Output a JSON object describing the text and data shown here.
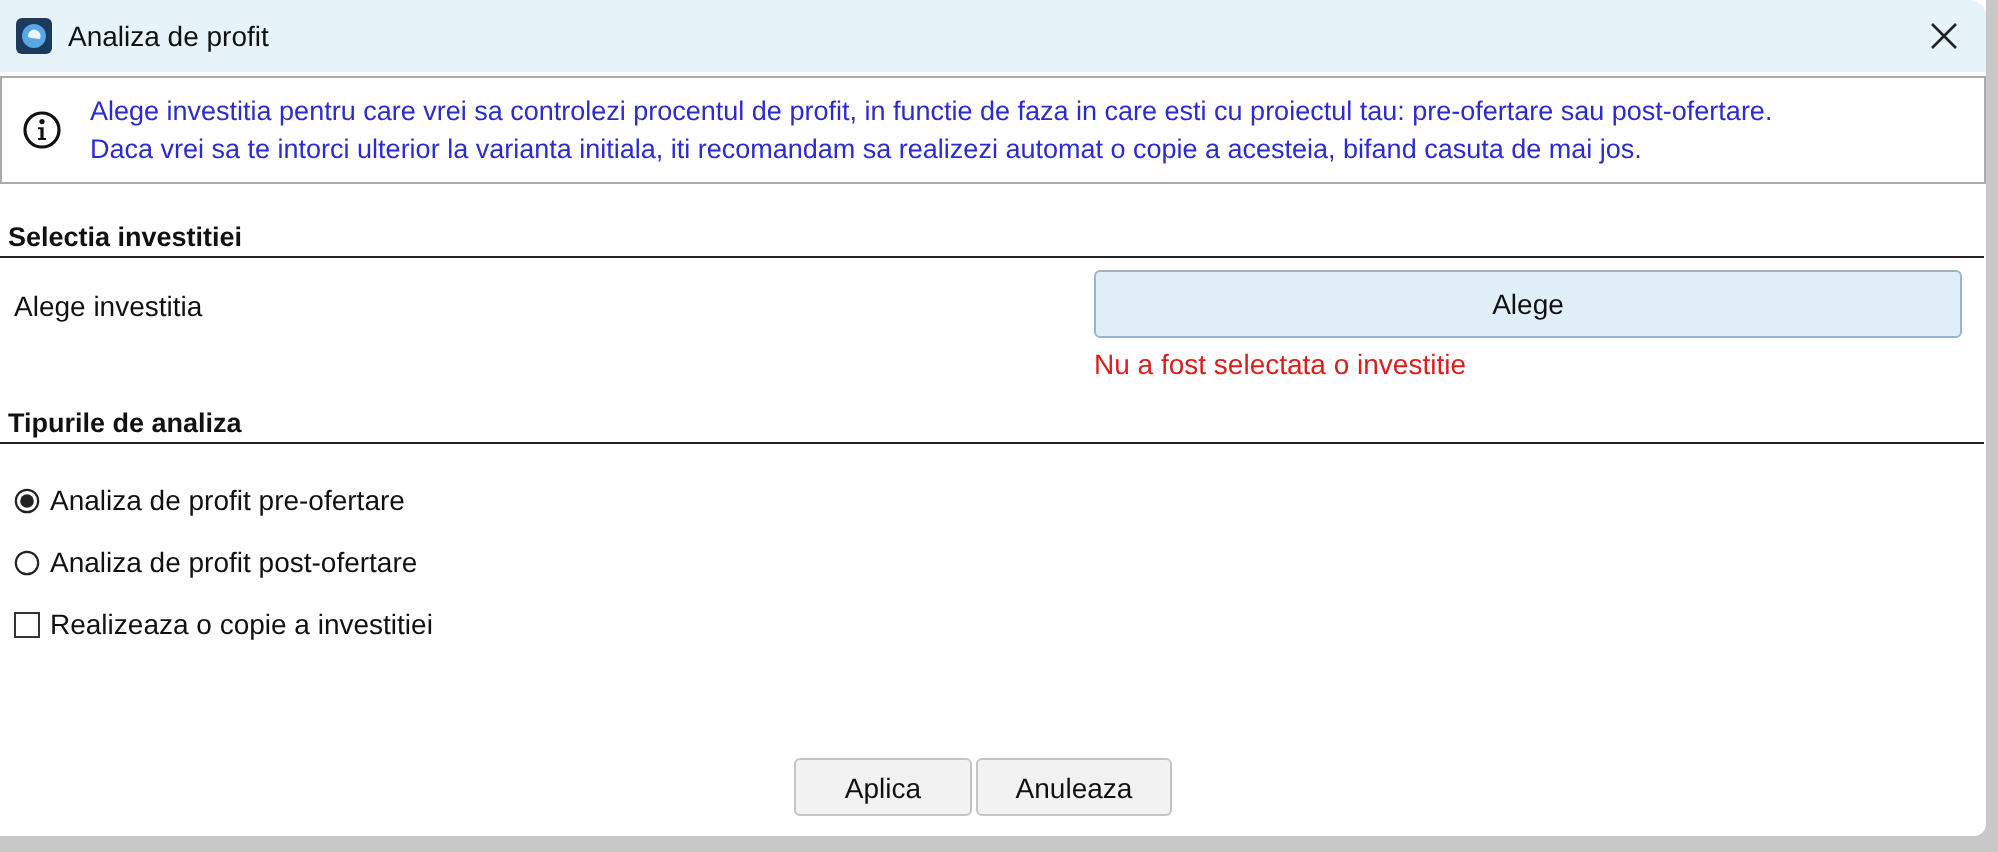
{
  "window": {
    "title": "Analiza de profit"
  },
  "info": {
    "lines": [
      "Alege investitia pentru care vrei sa controlezi procentul de profit, in functie de faza in care esti cu proiectul tau: pre-ofertare sau post-ofertare.",
      "Daca vrei sa te intorci ulterior la varianta initiala, iti recomandam sa realizezi automat o copie a acesteia, bifand casuta de mai jos."
    ]
  },
  "selection": {
    "heading": "Selectia investitiei",
    "label": "Alege investitia",
    "button": "Alege",
    "error": "Nu a fost selectata o investitie"
  },
  "analysis": {
    "heading": "Tipurile de analiza",
    "options": [
      {
        "kind": "radio",
        "label": "Analiza de profit pre-ofertare",
        "selected": true
      },
      {
        "kind": "radio",
        "label": "Analiza de profit post-ofertare",
        "selected": false
      },
      {
        "kind": "checkbox",
        "label": "Realizeaza o copie a investitiei",
        "checked": false
      }
    ]
  },
  "buttons": [
    "Aplica",
    "Anuleaza"
  ]
}
